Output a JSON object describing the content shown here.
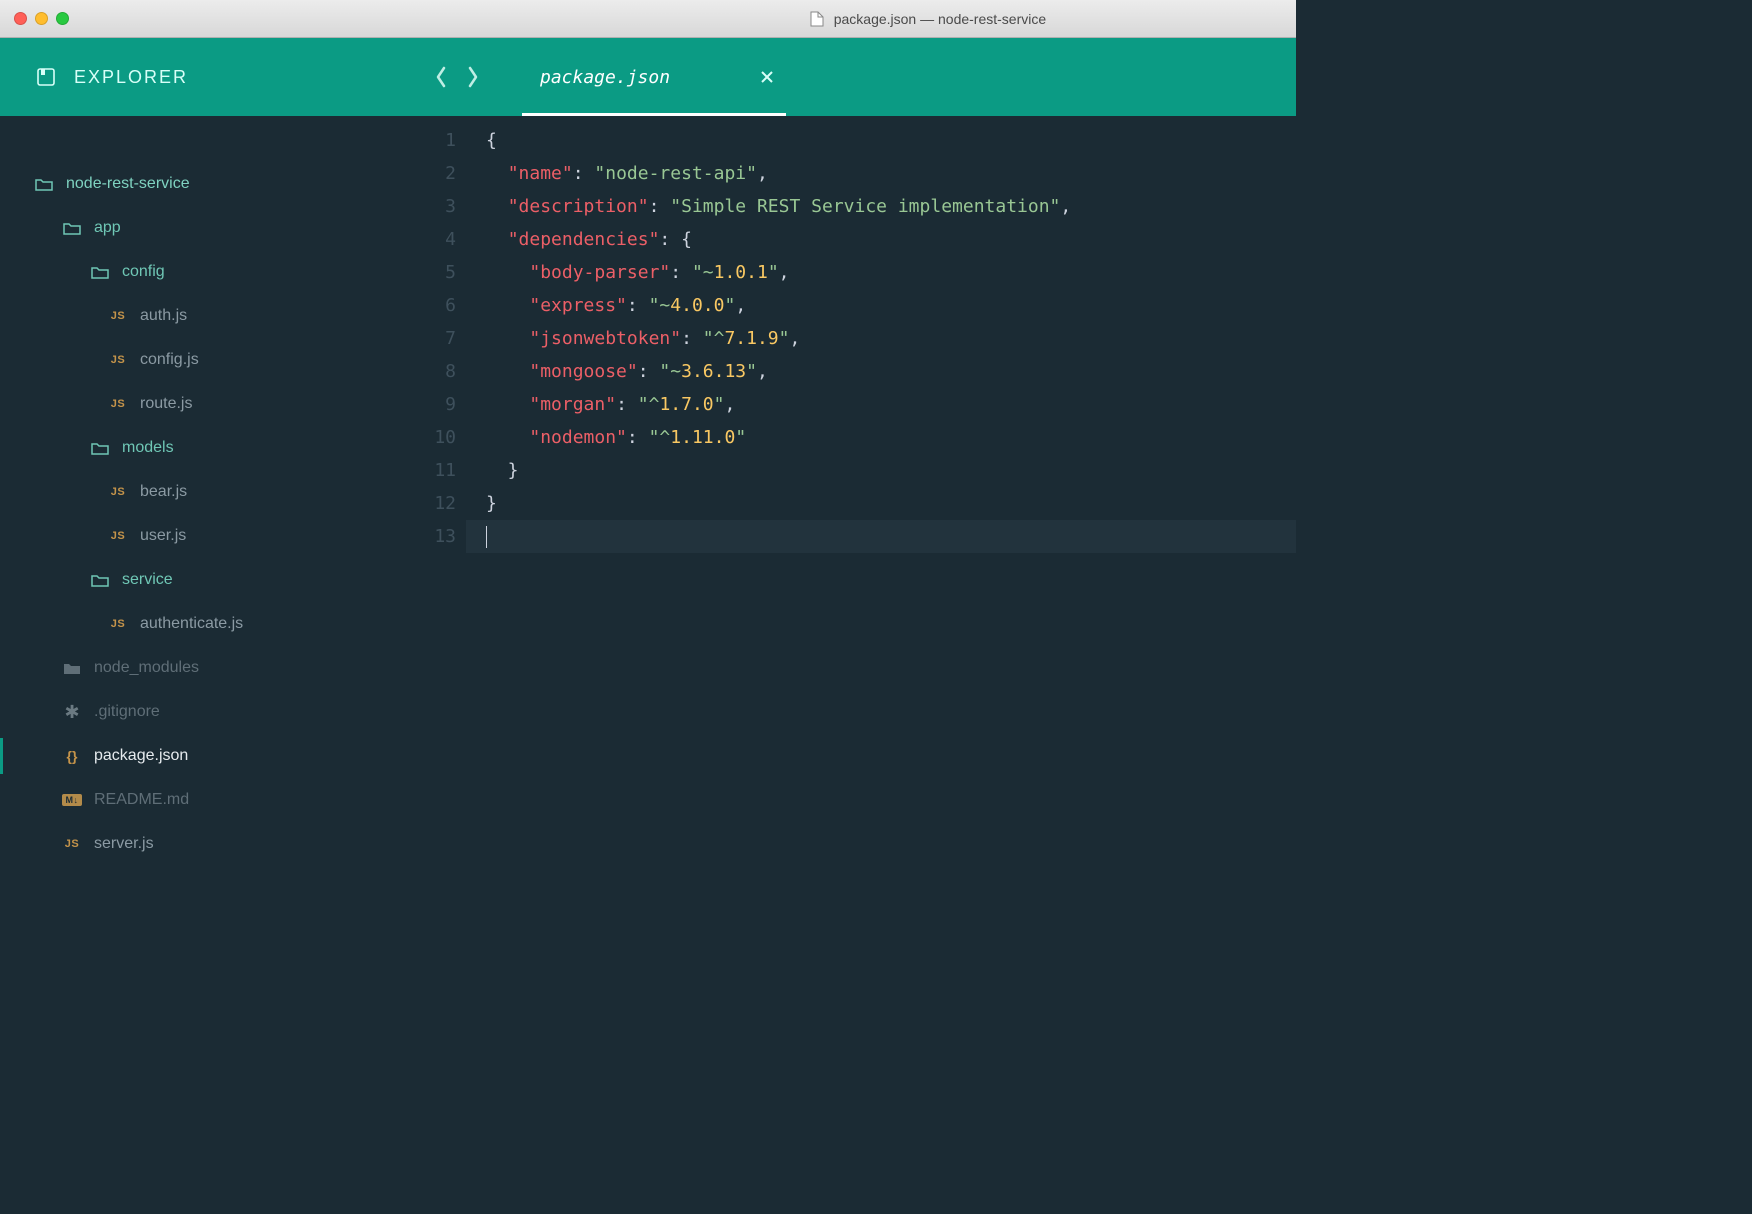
{
  "window": {
    "title": "package.json — node-rest-service"
  },
  "sidebar": {
    "title": "EXPLORER",
    "tree": [
      {
        "kind": "folder-open",
        "label": "node-rest-service",
        "indent": 0,
        "name": "project-root",
        "classes": "folder root"
      },
      {
        "kind": "folder-open",
        "label": "app",
        "indent": 1,
        "name": "folder-app",
        "classes": "folder"
      },
      {
        "kind": "folder-open",
        "label": "config",
        "indent": 2,
        "name": "folder-config",
        "classes": "folder"
      },
      {
        "kind": "js",
        "label": "auth.js",
        "indent": 3,
        "name": "file-auth-js"
      },
      {
        "kind": "js",
        "label": "config.js",
        "indent": 3,
        "name": "file-config-js"
      },
      {
        "kind": "js",
        "label": "route.js",
        "indent": 3,
        "name": "file-route-js"
      },
      {
        "kind": "folder-open",
        "label": "models",
        "indent": 2,
        "name": "folder-models",
        "classes": "folder"
      },
      {
        "kind": "js",
        "label": "bear.js",
        "indent": 3,
        "name": "file-bear-js"
      },
      {
        "kind": "js",
        "label": "user.js",
        "indent": 3,
        "name": "file-user-js"
      },
      {
        "kind": "folder-open",
        "label": "service",
        "indent": 2,
        "name": "folder-service",
        "classes": "folder"
      },
      {
        "kind": "js",
        "label": "authenticate.js",
        "indent": 3,
        "name": "file-authenticate-js"
      },
      {
        "kind": "folder",
        "label": "node_modules",
        "indent": 1,
        "name": "folder-node-modules",
        "classes": "dim"
      },
      {
        "kind": "gitignore",
        "label": ".gitignore",
        "indent": 1,
        "name": "file-gitignore",
        "classes": "dim"
      },
      {
        "kind": "json",
        "label": "package.json",
        "indent": 1,
        "name": "file-package-json",
        "classes": "active"
      },
      {
        "kind": "md",
        "label": "README.md",
        "indent": 1,
        "name": "file-readme-md",
        "classes": "dim"
      },
      {
        "kind": "js",
        "label": "server.js",
        "indent": 1,
        "name": "file-server-js"
      }
    ]
  },
  "tab": {
    "title": "package.json"
  },
  "code": {
    "line_count": 13,
    "lines": [
      [
        {
          "t": "{",
          "c": "p"
        }
      ],
      [
        {
          "t": "  ",
          "c": "p"
        },
        {
          "t": "\"name\"",
          "c": "k"
        },
        {
          "t": ": ",
          "c": "p"
        },
        {
          "t": "\"node-rest-api\"",
          "c": "s"
        },
        {
          "t": ",",
          "c": "p"
        }
      ],
      [
        {
          "t": "  ",
          "c": "p"
        },
        {
          "t": "\"description\"",
          "c": "k"
        },
        {
          "t": ": ",
          "c": "p"
        },
        {
          "t": "\"Simple REST Service implementation\"",
          "c": "s"
        },
        {
          "t": ",",
          "c": "p"
        }
      ],
      [
        {
          "t": "  ",
          "c": "p"
        },
        {
          "t": "\"dependencies\"",
          "c": "k"
        },
        {
          "t": ": {",
          "c": "p"
        }
      ],
      [
        {
          "t": "    ",
          "c": "p"
        },
        {
          "t": "\"body-parser\"",
          "c": "k"
        },
        {
          "t": ": ",
          "c": "p"
        },
        {
          "t": "\"~",
          "c": "s"
        },
        {
          "t": "1.0.1",
          "c": "n"
        },
        {
          "t": "\"",
          "c": "s"
        },
        {
          "t": ",",
          "c": "p"
        }
      ],
      [
        {
          "t": "    ",
          "c": "p"
        },
        {
          "t": "\"express\"",
          "c": "k"
        },
        {
          "t": ": ",
          "c": "p"
        },
        {
          "t": "\"~",
          "c": "s"
        },
        {
          "t": "4.0.0",
          "c": "n"
        },
        {
          "t": "\"",
          "c": "s"
        },
        {
          "t": ",",
          "c": "p"
        }
      ],
      [
        {
          "t": "    ",
          "c": "p"
        },
        {
          "t": "\"jsonwebtoken\"",
          "c": "k"
        },
        {
          "t": ": ",
          "c": "p"
        },
        {
          "t": "\"^",
          "c": "s"
        },
        {
          "t": "7.1.9",
          "c": "n"
        },
        {
          "t": "\"",
          "c": "s"
        },
        {
          "t": ",",
          "c": "p"
        }
      ],
      [
        {
          "t": "    ",
          "c": "p"
        },
        {
          "t": "\"mongoose\"",
          "c": "k"
        },
        {
          "t": ": ",
          "c": "p"
        },
        {
          "t": "\"~",
          "c": "s"
        },
        {
          "t": "3.6.13",
          "c": "n"
        },
        {
          "t": "\"",
          "c": "s"
        },
        {
          "t": ",",
          "c": "p"
        }
      ],
      [
        {
          "t": "    ",
          "c": "p"
        },
        {
          "t": "\"morgan\"",
          "c": "k"
        },
        {
          "t": ": ",
          "c": "p"
        },
        {
          "t": "\"^",
          "c": "s"
        },
        {
          "t": "1.7.0",
          "c": "n"
        },
        {
          "t": "\"",
          "c": "s"
        },
        {
          "t": ",",
          "c": "p"
        }
      ],
      [
        {
          "t": "    ",
          "c": "p"
        },
        {
          "t": "\"nodemon\"",
          "c": "k"
        },
        {
          "t": ": ",
          "c": "p"
        },
        {
          "t": "\"^",
          "c": "s"
        },
        {
          "t": "1.11.0",
          "c": "n"
        },
        {
          "t": "\"",
          "c": "s"
        }
      ],
      [
        {
          "t": "  }",
          "c": "p"
        }
      ],
      [
        {
          "t": "}",
          "c": "p"
        }
      ],
      []
    ]
  },
  "icons": {
    "js_badge": "JS",
    "md_badge": "M↓"
  }
}
